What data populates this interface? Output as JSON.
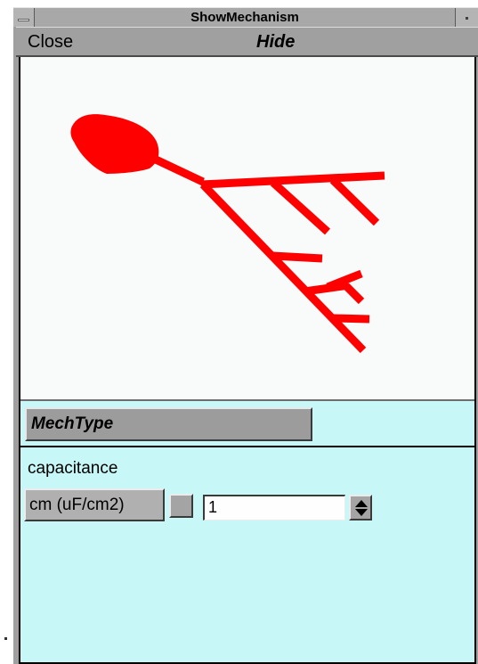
{
  "window": {
    "title": "ShowMechanism"
  },
  "menubar": {
    "close_label": "Close",
    "hide_label": "Hide"
  },
  "mechtype": {
    "label": "MechType"
  },
  "parameters": {
    "section_label": "capacitance",
    "button_label": "cm (uF/cm2)",
    "value": "1"
  },
  "shape_plot": {
    "color": "#ff0000",
    "background": "#f8fbfa"
  },
  "icons": {
    "window_menu": "window-menu-icon",
    "minimize": "minimize-icon",
    "spinner": "spinner-arrows-icon"
  }
}
